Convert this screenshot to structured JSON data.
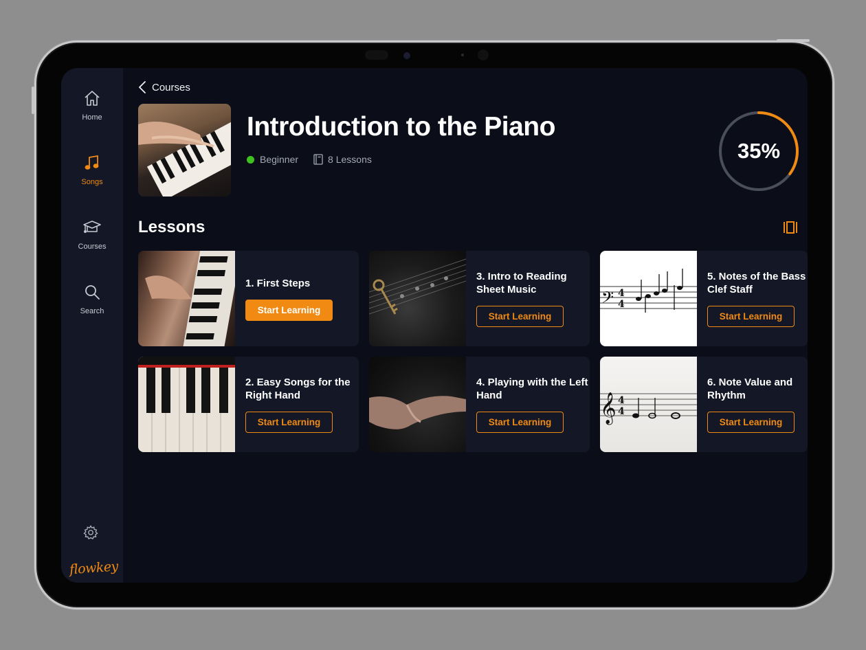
{
  "nav": {
    "items": [
      {
        "label": "Home",
        "icon": "home-icon"
      },
      {
        "label": "Songs",
        "icon": "music-note-icon",
        "active": true
      },
      {
        "label": "Courses",
        "icon": "graduation-cap-icon"
      },
      {
        "label": "Search",
        "icon": "search-icon"
      }
    ],
    "settings_icon": "gear-icon",
    "logo": "flowkey"
  },
  "header": {
    "back_label": "Courses",
    "title": "Introduction to the Piano",
    "level": "Beginner",
    "lessons_count": "8 Lessons",
    "progress_text": "35%",
    "progress_value": 0.35
  },
  "lessons": {
    "heading": "Lessons",
    "items": [
      {
        "title": "1. First Steps",
        "cta": "Start Learning",
        "image": "hand-on-piano-photo"
      },
      {
        "title": "2. Easy Songs for the Right Hand",
        "cta": "Start Learning",
        "image": "piano-keys-photo"
      },
      {
        "title": "3. Intro to Reading Sheet Music",
        "cta": "Start Learning",
        "image": "key-on-sheet-photo"
      },
      {
        "title": "4. Playing with the Left Hand",
        "cta": "Start Learning",
        "image": "open-hand-photo"
      },
      {
        "title": "5. Notes of the Bass Clef Staff",
        "cta": "Start Learning",
        "image": "bass-clef-staff"
      },
      {
        "title": "6. Note Value and Rhythm",
        "cta": "Start Learning",
        "image": "treble-clef-staff"
      }
    ]
  },
  "colors": {
    "accent": "#f08a12",
    "background": "#0b0e18",
    "card": "#141826",
    "level_dot": "#3fc21f"
  }
}
